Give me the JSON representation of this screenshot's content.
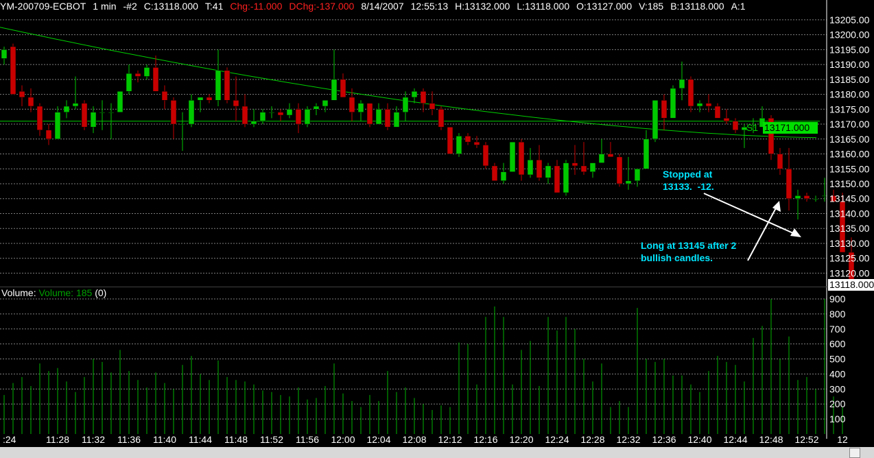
{
  "header": {
    "symbol": "YM-200709-ECBOT",
    "interval": "1 min",
    "chart_id": "-#2",
    "close": "C:13118.000",
    "ticks": "T:41",
    "change": "Chg:-11.000",
    "day_change": "DChg:-137.000",
    "date": "8/14/2007",
    "time": "12:55:13",
    "high": "H:13132.000",
    "low": "L:13118.000",
    "open": "O:13127.000",
    "volume": "V:185",
    "bid": "B:13118.000",
    "ask": "A:1"
  },
  "volume_panel": {
    "label": "Volume:",
    "indicator": "Volume: 185",
    "extra": "(0)"
  },
  "annotations": {
    "stopped": "Stopped at\n13133.  -12.",
    "long": "Long at 13145 after 2\nbullish candles."
  },
  "pivot": {
    "label": "S1",
    "value": "13171.000"
  },
  "last_price_tag": "13118.000",
  "colors": {
    "background": "#000000",
    "up_candle": "#00c800",
    "down_candle": "#c80000",
    "moving_average": "#00d000",
    "pivot_line": "#00d000",
    "grid": "#808080",
    "annotation_text": "#00e5ff",
    "text": "#ffffff",
    "header_red": "#ff2020",
    "volume_bars": "#00b400"
  },
  "chart_data": [
    {
      "type": "candlestick",
      "y_ticks": [
        13120,
        13125,
        13130,
        13135,
        13140,
        13145,
        13150,
        13155,
        13160,
        13165,
        13170,
        13175,
        13180,
        13185,
        13190,
        13195,
        13200,
        13205
      ],
      "y_tick_labels": [
        "13120.00",
        "13125.00",
        "13130.00",
        "13135.00",
        "13140.00",
        "13145.00",
        "13150.00",
        "13155.00",
        "13160.00",
        "13165.00",
        "13170.00",
        "13175.00",
        "13180.00",
        "13185.00",
        "13190.00",
        "13195.00",
        "13200.00",
        "13205.00"
      ],
      "ylim": [
        13115.5,
        13207.5
      ],
      "grid": true,
      "x_tick_labels": [
        ":24",
        "11:28",
        "11:32",
        "11:36",
        "11:40",
        "11:44",
        "11:48",
        "11:52",
        "11:56",
        "12:00",
        "12:04",
        "12:08",
        "12:12",
        "12:16",
        "12:20",
        "12:24",
        "12:28",
        "12:32",
        "12:36",
        "12:40",
        "12:44",
        "12:48",
        "12:52",
        "12"
      ],
      "x_tick_bar_index": [
        1,
        6,
        10,
        14,
        18,
        22,
        26,
        30,
        34,
        38,
        42,
        46,
        50,
        54,
        58,
        62,
        66,
        70,
        74,
        78,
        82,
        86,
        90,
        94
      ],
      "ohlc": [
        [
          13192,
          13196,
          13190,
          13195
        ],
        [
          13196,
          13197,
          13180,
          13180
        ],
        [
          13181,
          13183,
          13176,
          13179
        ],
        [
          13179,
          13182,
          13174,
          13176
        ],
        [
          13176,
          13177,
          13166,
          13168
        ],
        [
          13168,
          13170,
          13163,
          13165
        ],
        [
          13165,
          13176,
          13165,
          13174
        ],
        [
          13174,
          13178,
          13172,
          13176
        ],
        [
          13176,
          13186,
          13175,
          13177
        ],
        [
          13177,
          13178,
          13168,
          13169
        ],
        [
          13169,
          13176,
          13167,
          13174
        ],
        [
          13174,
          13178,
          13168,
          13174
        ],
        [
          13174,
          13177,
          13165,
          13174
        ],
        [
          13174,
          13181,
          13174,
          13181
        ],
        [
          13181,
          13190,
          13180,
          13187
        ],
        [
          13187,
          13188,
          13184,
          13186
        ],
        [
          13186,
          13190,
          13185,
          13189
        ],
        [
          13189,
          13193,
          13181,
          13181
        ],
        [
          13181,
          13183,
          13175,
          13178
        ],
        [
          13178,
          13179,
          13165,
          13170
        ],
        [
          13170,
          13174,
          13161,
          13170
        ],
        [
          13170,
          13180,
          13169,
          13178
        ],
        [
          13178,
          13179,
          13174,
          13179
        ],
        [
          13179,
          13180,
          13177,
          13178
        ],
        [
          13178,
          13195,
          13176,
          13188
        ],
        [
          13188,
          13189,
          13177,
          13178
        ],
        [
          13178,
          13186,
          13171,
          13176
        ],
        [
          13176,
          13180,
          13169,
          13170
        ],
        [
          13170,
          13175,
          13169,
          13171
        ],
        [
          13171,
          13175,
          13170,
          13174
        ],
        [
          13174,
          13176,
          13172,
          13174
        ],
        [
          13174,
          13175,
          13171,
          13173
        ],
        [
          13173,
          13177,
          13172,
          13175
        ],
        [
          13175,
          13177,
          13167,
          13170
        ],
        [
          13170,
          13176,
          13169,
          13175
        ],
        [
          13175,
          13177,
          13173,
          13176
        ],
        [
          13176,
          13178,
          13174,
          13178
        ],
        [
          13178,
          13195,
          13178,
          13185
        ],
        [
          13185,
          13187,
          13179,
          13179
        ],
        [
          13179,
          13182,
          13171,
          13174
        ],
        [
          13174,
          13178,
          13171,
          13177
        ],
        [
          13177,
          13177,
          13169,
          13170
        ],
        [
          13170,
          13177,
          13170,
          13175
        ],
        [
          13175,
          13177,
          13168,
          13169
        ],
        [
          13169,
          13176,
          13169,
          13174
        ],
        [
          13174,
          13181,
          13171,
          13179
        ],
        [
          13179,
          13182,
          13177,
          13181
        ],
        [
          13181,
          13182,
          13174,
          13177
        ],
        [
          13177,
          13181,
          13173,
          13175
        ],
        [
          13175,
          13176,
          13168,
          13169
        ],
        [
          13169,
          13169,
          13160,
          13160
        ],
        [
          13160,
          13167,
          13159,
          13166
        ],
        [
          13166,
          13167,
          13163,
          13164
        ],
        [
          13164,
          13166,
          13162,
          13163
        ],
        [
          13163,
          13164,
          13155,
          13156
        ],
        [
          13156,
          13157,
          13151,
          13151
        ],
        [
          13151,
          13157,
          13150,
          13154
        ],
        [
          13154,
          13164,
          13154,
          13164
        ],
        [
          13164,
          13165,
          13151,
          13153
        ],
        [
          13153,
          13162,
          13152,
          13158
        ],
        [
          13158,
          13163,
          13151,
          13152
        ],
        [
          13152,
          13157,
          13150,
          13156
        ],
        [
          13156,
          13158,
          13147,
          13147
        ],
        [
          13147,
          13158,
          13146,
          13157
        ],
        [
          13157,
          13163,
          13153,
          13156
        ],
        [
          13156,
          13164,
          13153,
          13154
        ],
        [
          13154,
          13157,
          13152,
          13157
        ],
        [
          13157,
          13165,
          13157,
          13160
        ],
        [
          13160,
          13164,
          13159,
          13159
        ],
        [
          13159,
          13160,
          13149,
          13150
        ],
        [
          13150,
          13159,
          13148,
          13151
        ],
        [
          13151,
          13155,
          13149,
          13155
        ],
        [
          13155,
          13168,
          13155,
          13165
        ],
        [
          13165,
          13178,
          13164,
          13178
        ],
        [
          13178,
          13180,
          13168,
          13172
        ],
        [
          13172,
          13183,
          13172,
          13182
        ],
        [
          13182,
          13191,
          13178,
          13185
        ],
        [
          13185,
          13186,
          13174,
          13176
        ],
        [
          13176,
          13178,
          13174,
          13177
        ],
        [
          13177,
          13180,
          13174,
          13176
        ],
        [
          13176,
          13177,
          13172,
          13172
        ],
        [
          13172,
          13175,
          13170,
          13171
        ],
        [
          13171,
          13172,
          13167,
          13168
        ],
        [
          13168,
          13170,
          13162,
          13169
        ],
        [
          13169,
          13172,
          13167,
          13169
        ],
        [
          13169,
          13176,
          13169,
          13172
        ],
        [
          13172,
          13173,
          13158,
          13160
        ],
        [
          13160,
          13162,
          13153,
          13155
        ],
        [
          13155,
          13162,
          13141,
          13145
        ],
        [
          13145,
          13148,
          13138,
          13146
        ],
        [
          13146,
          13147,
          13144,
          13145
        ],
        [
          13145,
          13146,
          13144,
          13145
        ],
        [
          13146,
          13152,
          13144,
          13146
        ],
        [
          13146,
          13148,
          13144,
          13144
        ],
        [
          13144,
          13147,
          13128,
          13127
        ],
        [
          13127,
          13132,
          13118,
          13118
        ]
      ],
      "moving_average": {
        "start": 13202.5,
        "end": 13165.5
      },
      "pivot_level": 13171
    },
    {
      "type": "bar",
      "title": "Volume",
      "y_ticks": [
        100,
        200,
        300,
        400,
        500,
        600,
        700,
        800,
        900
      ],
      "ylim": [
        0,
        900
      ],
      "values": [
        260,
        340,
        380,
        320,
        470,
        420,
        440,
        350,
        280,
        380,
        500,
        480,
        410,
        560,
        420,
        360,
        310,
        410,
        340,
        300,
        460,
        520,
        400,
        360,
        490,
        380,
        360,
        350,
        330,
        290,
        280,
        260,
        250,
        310,
        230,
        240,
        320,
        470,
        270,
        220,
        180,
        260,
        220,
        420,
        280,
        310,
        240,
        200,
        160,
        190,
        180,
        610,
        600,
        330,
        780,
        850,
        780,
        330,
        560,
        620,
        320,
        780,
        690,
        780,
        700,
        500,
        350,
        470,
        180,
        220,
        180,
        840,
        500,
        480,
        500,
        390,
        390,
        330,
        280,
        420,
        520,
        480,
        460,
        350,
        640,
        720,
        900,
        500,
        650,
        360,
        380,
        300,
        900,
        250,
        180
      ]
    }
  ]
}
